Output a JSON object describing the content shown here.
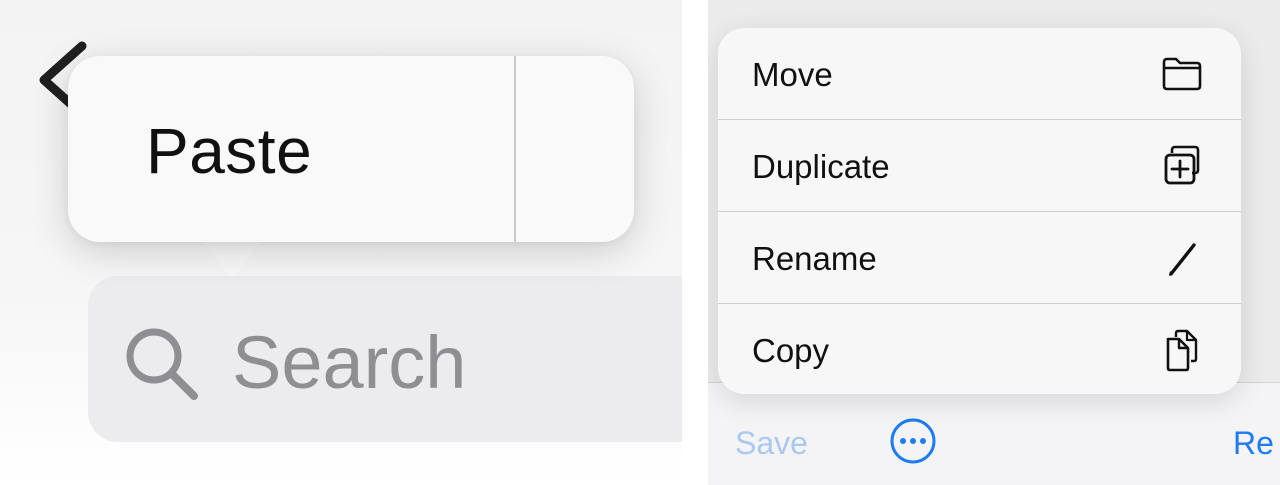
{
  "left_panel": {
    "back_icon": "chevron-left-icon",
    "popover": {
      "paste_label": "Paste"
    },
    "search": {
      "icon": "magnifying-glass-icon",
      "placeholder": "Search"
    }
  },
  "right_panel": {
    "menu": {
      "items": [
        {
          "label": "Move",
          "icon": "folder-icon"
        },
        {
          "label": "Duplicate",
          "icon": "duplicate-plus-icon"
        },
        {
          "label": "Rename",
          "icon": "pencil-icon"
        },
        {
          "label": "Copy",
          "icon": "copy-documents-icon"
        }
      ]
    },
    "toolbar": {
      "save_label": "Save",
      "more_icon": "ellipsis-circle-icon",
      "right_partial_label": "Re"
    }
  },
  "colors": {
    "accent_blue": "#1e7cf2",
    "disabled_blue": "#a9c9ef",
    "placeholder_gray": "#8e8e93"
  }
}
